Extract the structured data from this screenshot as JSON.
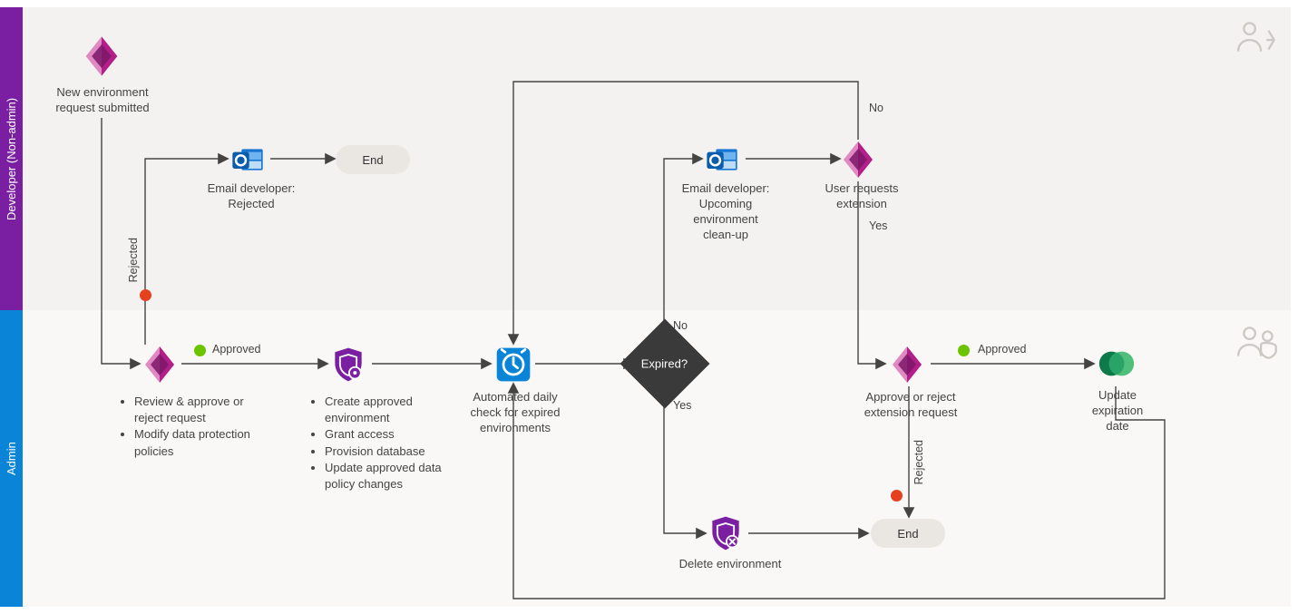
{
  "lanes": {
    "dev": "Developer (Non-admin)",
    "admin": "Admin"
  },
  "nodes": {
    "newRequest": "New environment\nrequest submitted",
    "emailRejected": "Email developer:\nRejected",
    "end1": "End",
    "reviewApprove": [
      "Review & approve or reject request",
      "Modify data protection policies"
    ],
    "createEnv": [
      "Create approved environment",
      "Grant access",
      "Provision database",
      "Update approved data policy changes"
    ],
    "dailyCheck": "Automated daily\ncheck for expired\nenvironments",
    "expired": "Expired?",
    "emailCleanup": "Email developer:\nUpcoming\nenvironment\nclean-up",
    "userExt": "User requests\nextension",
    "approveExt": "Approve or reject\nextension request",
    "updateExp": "Update\nexpiration\ndate",
    "deleteEnv": "Delete environment",
    "end2": "End"
  },
  "edgeLabels": {
    "approved1": "Approved",
    "rejected1": "Rejected",
    "yes1": "Yes",
    "no1": "No",
    "yes2": "Yes",
    "no2": "No",
    "approved2": "Approved",
    "rejected2": "Rejected"
  },
  "colors": {
    "devLane": "#7b1fa2",
    "adminLane": "#0a84d6",
    "green": "#6ac500",
    "red": "#e6411e"
  }
}
